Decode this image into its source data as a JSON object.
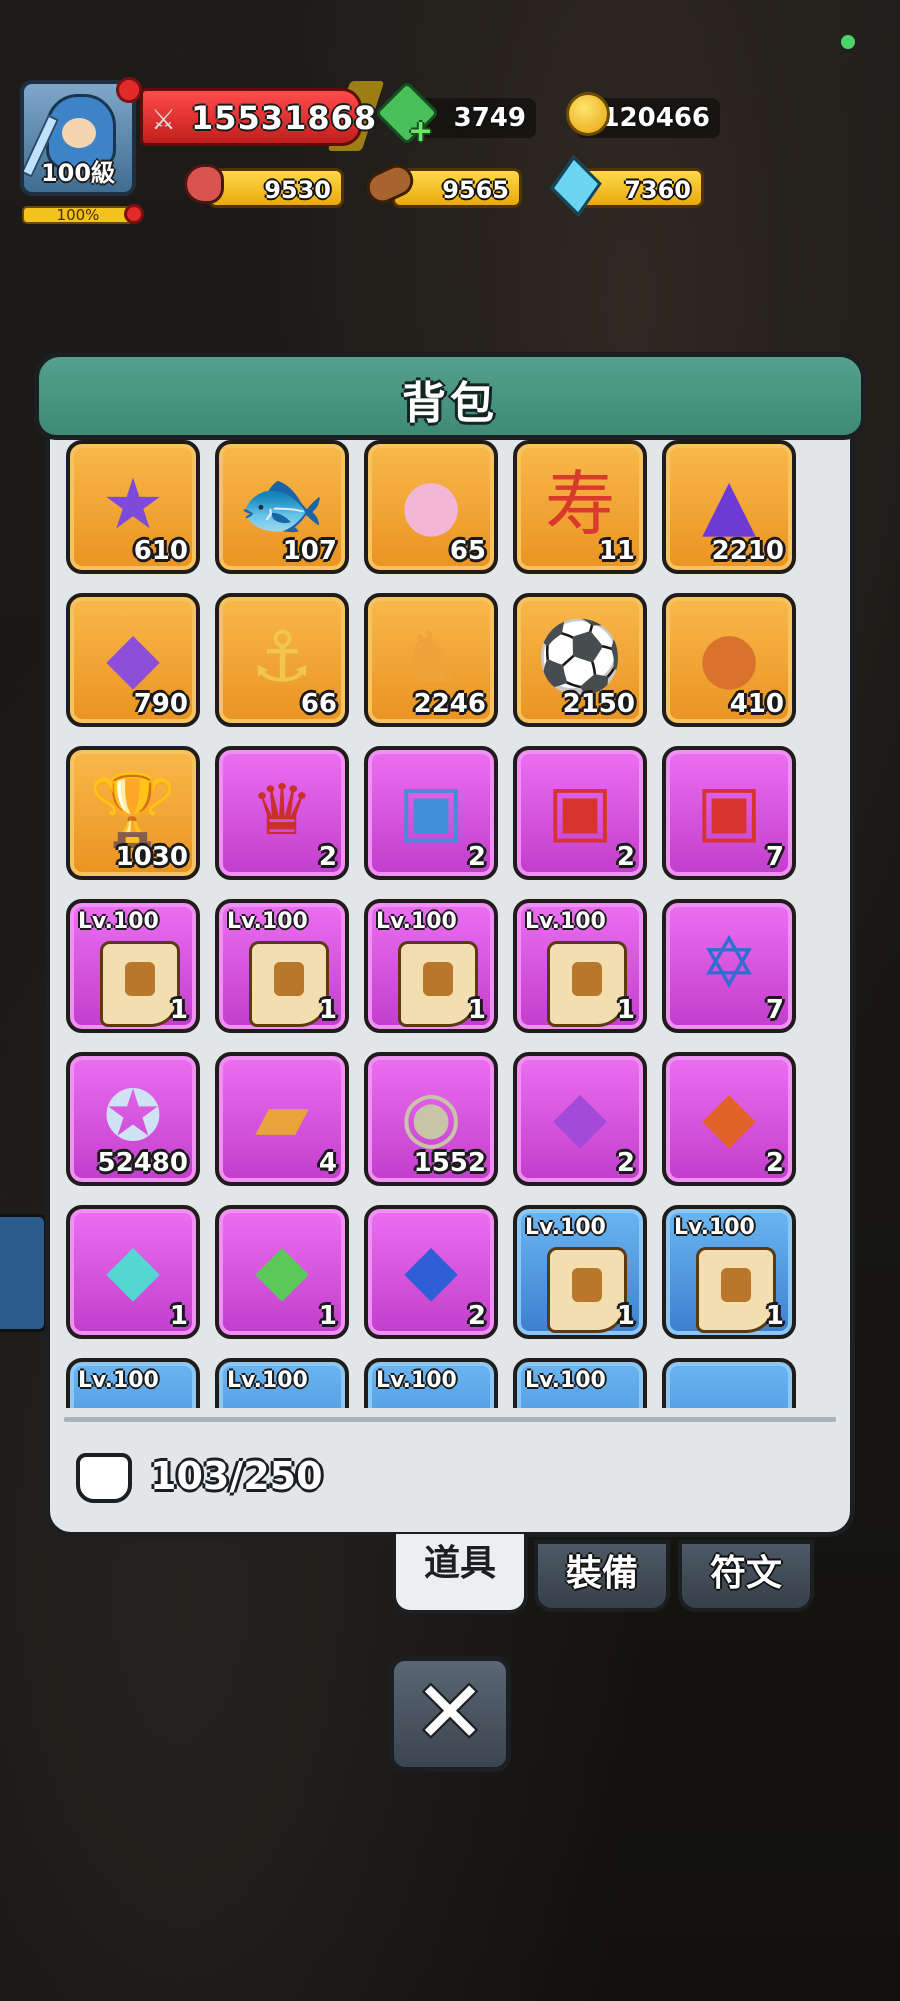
{
  "hud": {
    "level": "100級",
    "exp_percent": "100%",
    "power": "15531868",
    "gems": "3749",
    "gold": "120466",
    "meat": "9530",
    "wood": "9565",
    "crystal": "7360"
  },
  "panel": {
    "title": "背包",
    "capacity": "103/250"
  },
  "tabs": [
    {
      "label": "道具",
      "active": true
    },
    {
      "label": "裝備",
      "active": false
    },
    {
      "label": "符文",
      "active": false
    }
  ],
  "items": [
    {
      "name": "star-medal-icon",
      "rarity": "orange",
      "count": "610",
      "icon": "★",
      "color": "#7d4ad9"
    },
    {
      "name": "fish-icon",
      "rarity": "orange",
      "count": "107",
      "icon": "🐟",
      "color": "#e9dcb9"
    },
    {
      "name": "peach-icon",
      "rarity": "orange",
      "count": "65",
      "icon": "●",
      "color": "#f3b6d6"
    },
    {
      "name": "longevity-charm-icon",
      "rarity": "orange",
      "count": "11",
      "icon": "寿",
      "color": "#d93a2b"
    },
    {
      "name": "purple-crystal-icon",
      "rarity": "orange",
      "count": "2210",
      "icon": "▲",
      "color": "#6e3ad6"
    },
    {
      "name": "amethyst-icon",
      "rarity": "orange",
      "count": "790",
      "icon": "◆",
      "color": "#8e4fd8"
    },
    {
      "name": "anchor-icon",
      "rarity": "orange",
      "count": "66",
      "icon": "⚓",
      "color": "#f2c64e"
    },
    {
      "name": "rocking-horse-icon",
      "rarity": "orange",
      "count": "2246",
      "icon": "♞",
      "color": "#f0a33a"
    },
    {
      "name": "soccer-ball-icon",
      "rarity": "orange",
      "count": "2150",
      "icon": "⚽",
      "color": "#111111"
    },
    {
      "name": "basketball-icon",
      "rarity": "orange",
      "count": "410",
      "icon": "●",
      "color": "#d9722b"
    },
    {
      "name": "trophy-icon",
      "rarity": "orange",
      "count": "1030",
      "icon": "🏆",
      "color": "#e9b320"
    },
    {
      "name": "hero-card-icon",
      "rarity": "purple",
      "count": "2",
      "icon": "♛",
      "color": "#c9302c"
    },
    {
      "name": "blue-chest-icon",
      "rarity": "purple",
      "count": "2",
      "icon": "▣",
      "color": "#3f8fd9"
    },
    {
      "name": "fire-chest-icon",
      "rarity": "purple",
      "count": "2",
      "icon": "▣",
      "color": "#d7332f"
    },
    {
      "name": "mystery-chest-icon",
      "rarity": "purple",
      "count": "7",
      "icon": "▣",
      "color": "#d7332f"
    },
    {
      "name": "weapon-scroll-icon",
      "rarity": "purple",
      "count": "1",
      "lv": "Lv.100",
      "scroll": true
    },
    {
      "name": "armor-scroll-icon",
      "rarity": "purple",
      "count": "1",
      "lv": "Lv.100",
      "scroll": true
    },
    {
      "name": "boots-scroll-icon",
      "rarity": "purple",
      "count": "1",
      "lv": "Lv.100",
      "scroll": true
    },
    {
      "name": "ring-scroll-icon",
      "rarity": "purple",
      "count": "1",
      "lv": "Lv.100",
      "scroll": true
    },
    {
      "name": "star-badge-icon",
      "rarity": "purple",
      "count": "7",
      "icon": "✡",
      "color": "#2f6fd1"
    },
    {
      "name": "winged-star-icon",
      "rarity": "purple",
      "count": "52480",
      "icon": "✪",
      "color": "#cfe3f5"
    },
    {
      "name": "ticket-icon",
      "rarity": "purple",
      "count": "4",
      "icon": "▰",
      "color": "#e9a53a"
    },
    {
      "name": "spiral-stone-icon",
      "rarity": "purple",
      "count": "1552",
      "icon": "◉",
      "color": "#c8c4a8"
    },
    {
      "name": "purple-ore-icon",
      "rarity": "purple",
      "count": "2",
      "icon": "◆",
      "color": "#a34bd8"
    },
    {
      "name": "orange-ore-icon",
      "rarity": "purple",
      "count": "2",
      "icon": "◆",
      "color": "#e2632a"
    },
    {
      "name": "cyan-ore-icon",
      "rarity": "purple",
      "count": "1",
      "icon": "◆",
      "color": "#56d6d2"
    },
    {
      "name": "green-ore-icon",
      "rarity": "purple",
      "count": "1",
      "icon": "◆",
      "color": "#5bc85a"
    },
    {
      "name": "blue-ore-icon",
      "rarity": "purple",
      "count": "2",
      "icon": "◆",
      "color": "#2f5fd6"
    },
    {
      "name": "armor-scroll-blue-icon",
      "rarity": "blue",
      "count": "1",
      "lv": "Lv.100",
      "scroll": true
    },
    {
      "name": "belt-scroll-blue-icon",
      "rarity": "blue",
      "count": "1",
      "lv": "Lv.100",
      "scroll": true
    },
    {
      "name": "partial-item-icon",
      "rarity": "blue",
      "count": "",
      "lv": "Lv.100",
      "scroll": false
    },
    {
      "name": "partial-item-icon",
      "rarity": "blue",
      "count": "",
      "lv": "Lv.100",
      "scroll": false
    },
    {
      "name": "partial-item-icon",
      "rarity": "blue",
      "count": "",
      "lv": "Lv.100",
      "scroll": false
    },
    {
      "name": "partial-item-icon",
      "rarity": "blue",
      "count": "",
      "lv": "Lv.100",
      "scroll": false
    },
    {
      "name": "partial-item-icon",
      "rarity": "blue",
      "count": "",
      "lv": "",
      "scroll": false
    }
  ],
  "close_symbol": "✕"
}
